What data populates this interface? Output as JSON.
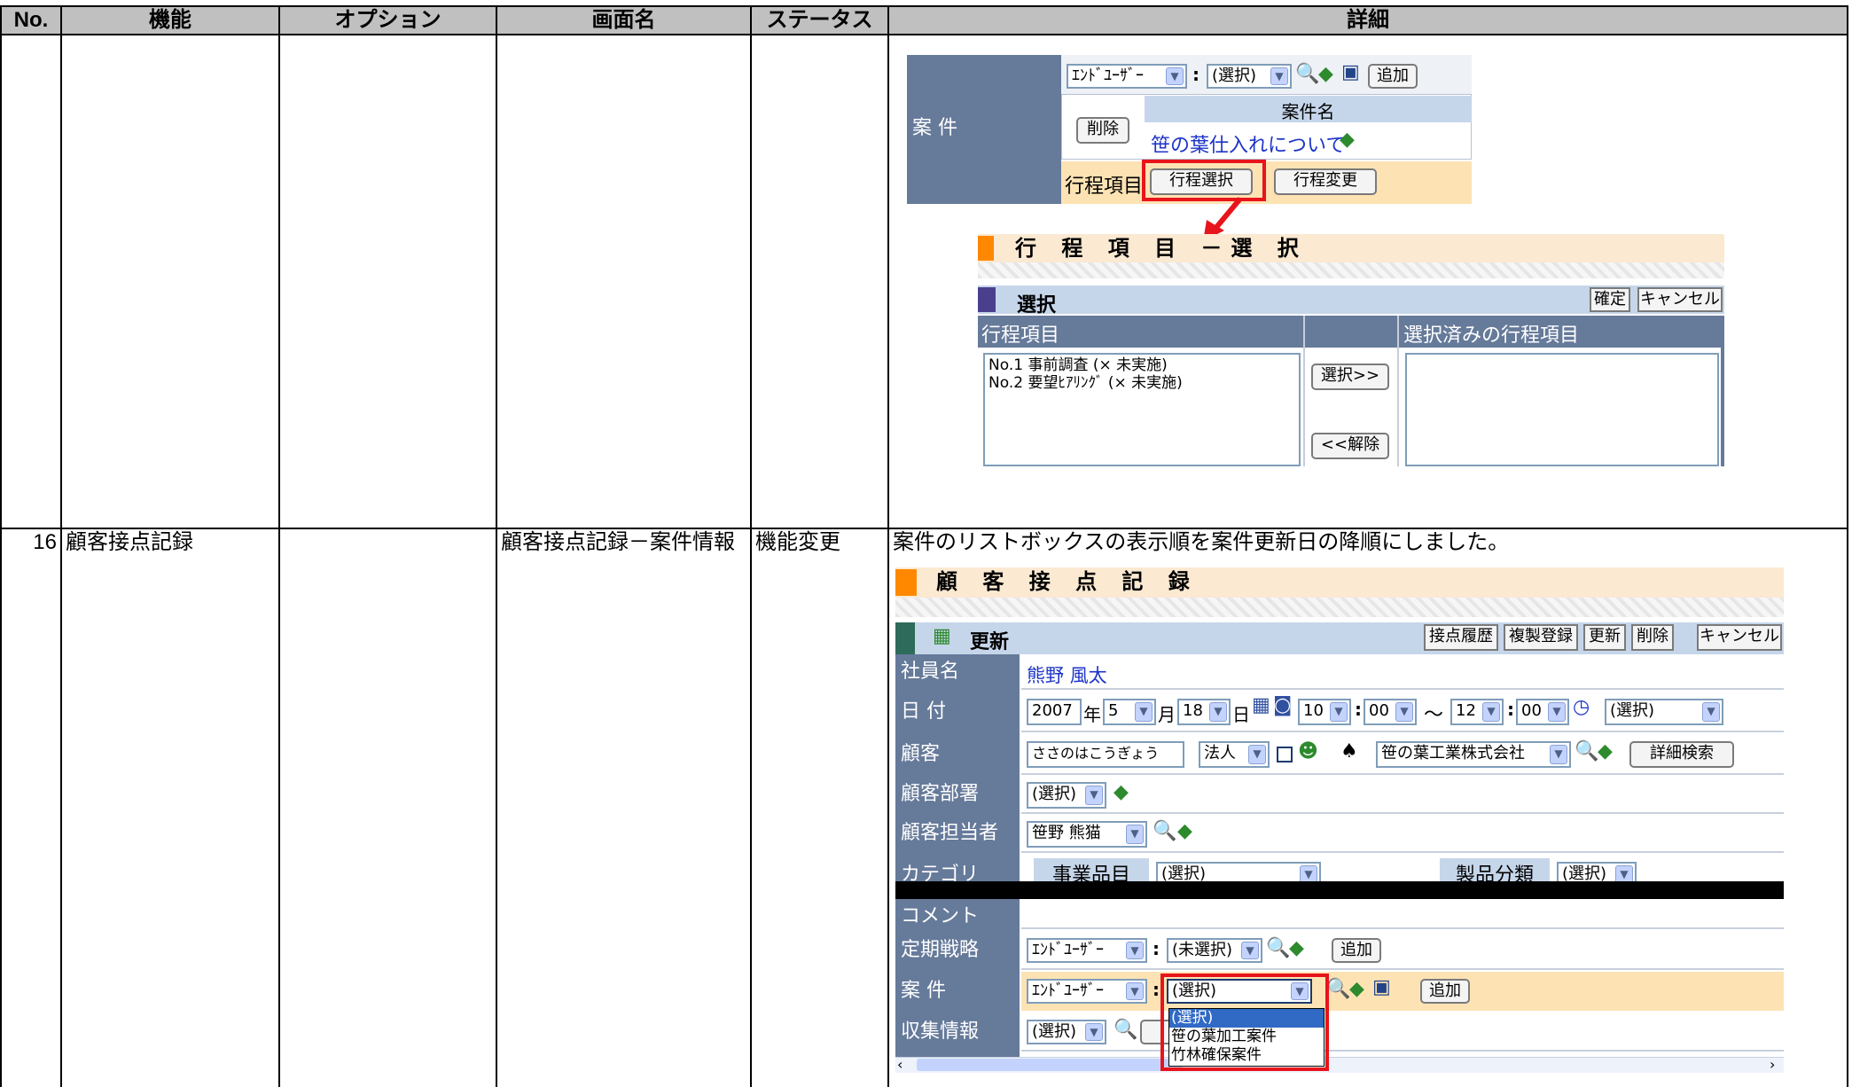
{
  "headers": {
    "no": "No.",
    "feature": "機能",
    "option": "オプション",
    "screen": "画面名",
    "status": "ステータス",
    "detail": "詳細"
  },
  "row16": {
    "no": "16",
    "feature": "顧客接点記録",
    "screen": "顧客接点記録－案件情報",
    "status": "機能変更",
    "detail": "案件のリストボックスの表示順を案件更新日の降順にしました。"
  },
  "shot1": {
    "anken_label": "案 件",
    "enduser": "ｴﾝﾄﾞﾕｰｻﾞｰ",
    "colon": ":",
    "select_placeholder": "(選択)",
    "add": "追加",
    "delete": "削除",
    "col_name": "案件名",
    "project_link": "笹の葉仕入れについて",
    "process_label": "行程項目",
    "process_select": "行程選択",
    "process_change": "行程変更"
  },
  "shot2": {
    "title": "行 程 項 目 －選 択",
    "sub_title": "選択",
    "confirm": "確定",
    "cancel": "キャンセル",
    "left_header": "行程項目",
    "right_header": "選択済みの行程項目",
    "items": [
      "No.1 事前調査 (× 未実施)",
      "No.2 要望ﾋｱﾘﾝｸﾞ (× 未実施)"
    ],
    "select_btn": "選択>>",
    "release_btn": "<<解除"
  },
  "shot3": {
    "title": "顧 客 接 点 記 録",
    "update": "更新",
    "buttons": [
      "接点履歴",
      "複製登録",
      "更新",
      "削除",
      "キャンセル"
    ],
    "labels": {
      "employee": "社員名",
      "date": "日 付",
      "customer": "顧客",
      "dept": "顧客部署",
      "contact": "顧客担当者",
      "category": "カテゴリ",
      "comment": "コメント",
      "strategy": "定期戦略",
      "anken": "案 件",
      "collect": "収集情報"
    },
    "employee_name": "熊野 風太",
    "date": {
      "year": "2007",
      "year_unit": "年",
      "month": "5",
      "month_unit": "月",
      "day": "18",
      "day_unit": "日",
      "h1": "10",
      "m1": "00",
      "tilde": "～",
      "h2": "12",
      "m2": "00",
      "type": "(選択)"
    },
    "customer_kana": "ささのはこうぎょう",
    "customer_type": "法人",
    "customer_company": "笹の葉工業株式会社",
    "detail_search": "詳細検索",
    "dept_select": "(選択)",
    "contact_select": "笹野 熊猫",
    "tab_business": "事業品目",
    "tab_product": "製品分類",
    "enduser": "ｴﾝﾄﾞﾕｰｻﾞｰ",
    "unselected": "(未選択)",
    "select_placeholder": "(選択)",
    "add": "追加",
    "dropdown_options": [
      "(選択)",
      "笹の葉加工案件",
      "竹林確保案件"
    ]
  }
}
